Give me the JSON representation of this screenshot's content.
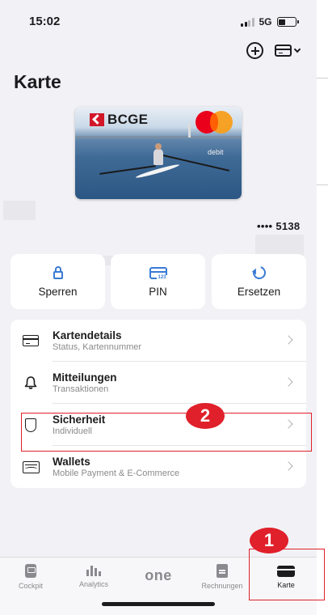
{
  "status_bar": {
    "time": "15:02",
    "network": "5G"
  },
  "page": {
    "title": "Karte"
  },
  "card": {
    "bank": "BCGE",
    "type": "debit",
    "number_masked": "•••• 5138"
  },
  "quick_actions": [
    {
      "label": "Sperren",
      "icon": "lock-icon"
    },
    {
      "label": "PIN",
      "icon": "pin-icon"
    },
    {
      "label": "Ersetzen",
      "icon": "replace-icon"
    }
  ],
  "menu": [
    {
      "title": "Kartendetails",
      "subtitle": "Status, Kartennummer",
      "icon": "card-icon"
    },
    {
      "title": "Mitteilungen",
      "subtitle": "Transaktionen",
      "icon": "bell-icon"
    },
    {
      "title": "Sicherheit",
      "subtitle": "Individuell",
      "icon": "shield-icon"
    },
    {
      "title": "Wallets",
      "subtitle": "Mobile Payment & E-Commerce",
      "icon": "wallet-icon"
    }
  ],
  "annotations": [
    {
      "number": "1"
    },
    {
      "number": "2"
    }
  ],
  "tabbar": [
    {
      "label": "Cockpit"
    },
    {
      "label": "Analytics"
    },
    {
      "label": "one"
    },
    {
      "label": "Rechnungen"
    },
    {
      "label": "Karte",
      "active": true
    }
  ],
  "colors": {
    "accent": "#3a7bd5",
    "annotation": "#e0202a",
    "brand_red": "#d3172a"
  }
}
